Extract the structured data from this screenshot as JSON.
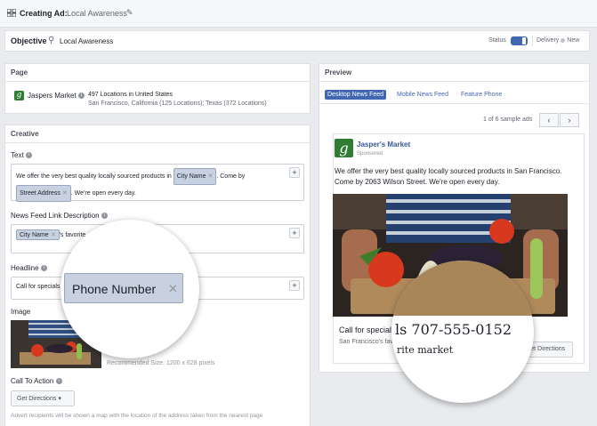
{
  "header": {
    "title_strong": "Creating Ad:",
    "title_light": "Local Awareness"
  },
  "objective": {
    "label": "Objective",
    "value": "Local Awareness",
    "status_label": "Status",
    "delivery_label": "Delivery",
    "delivery_value": "New"
  },
  "page": {
    "heading": "Page",
    "name": "Jaspers Market",
    "locations": "497 Locations in United States",
    "locations_detail": "San Francisco, California (125 Locations); Texas (372 Locations)"
  },
  "creative": {
    "heading": "Creative",
    "text_label": "Text",
    "text_part1": "We offer the very best quality locally sourced products in",
    "token_city": "City Name",
    "text_part2": ". Come by",
    "token_street": "Street Address",
    "text_part3": ". We're open every day.",
    "link_desc_label": "News Feed Link Description",
    "link_desc_token": "City Name",
    "link_desc_text": "'s favorite",
    "headline_label": "Headline",
    "headline_text": "Call for specials",
    "headline_token_zoom": "Phone Number",
    "image_label": "Image",
    "recommended_label": "Recommended Size:",
    "recommended_value": "1200 x 628 pixels",
    "cta_label": "Call To Action",
    "cta_value": "Get Directions",
    "footnote": "Advert recipients will be shown a map with the location of the address taken from the nearest page"
  },
  "preview": {
    "heading": "Preview",
    "tabs": [
      "Desktop News Feed",
      "Mobile News Feed",
      "Feature Phone"
    ],
    "pager": "1 of 6 sample ads",
    "ad_page_name": "Jasper's Market",
    "ad_sponsored": "Sponsored",
    "ad_text": "We offer the very best quality locally sourced products in San Francisco. Come by 2063 Wilson Street. We're open every day.",
    "ad_headline": "Call for specials",
    "ad_link_desc": "San Francisco's favorite market",
    "ad_button": "Get Directions",
    "zoom_phone": "ls 707-555-0152",
    "zoom_sub": "rite market"
  },
  "icons": {
    "logo_letter": "g",
    "plus": "+",
    "close": "✕",
    "prev": "‹",
    "next": "›",
    "dropdown": "▾",
    "pin": "⚲",
    "pencil": "✎",
    "info": "i"
  },
  "colors": {
    "accent": "#4267b2",
    "brand_green": "#2e7d32",
    "token_bg": "#c8d1e0"
  }
}
